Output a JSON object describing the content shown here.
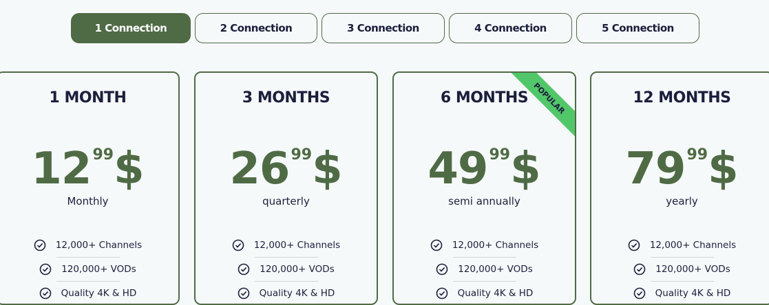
{
  "connections": [
    {
      "label": "1 Connection",
      "active": true
    },
    {
      "label": "2 Connection",
      "active": false
    },
    {
      "label": "3 Connection",
      "active": false
    },
    {
      "label": "4 Connection",
      "active": false
    },
    {
      "label": "5 Connection",
      "active": false
    }
  ],
  "plans": [
    {
      "title": "1 MONTH",
      "price_whole": "12",
      "price_cents": "99",
      "currency": "$",
      "period": "Monthly",
      "features": [
        "12,000+ Channels",
        "120,000+ VODs",
        "Quality 4K & HD"
      ]
    },
    {
      "title": "3 MONTHS",
      "price_whole": "26",
      "price_cents": "99",
      "currency": "$",
      "period": "quarterly",
      "features": [
        "12,000+ Channels",
        "120,000+ VODs",
        "Quality 4K & HD"
      ]
    },
    {
      "title": "6 MONTHS",
      "price_whole": "49",
      "price_cents": "99",
      "currency": "$",
      "period": "semi annually",
      "badge": "POPULAR",
      "features": [
        "12,000+ Channels",
        "120,000+ VODs",
        "Quality 4K & HD"
      ]
    },
    {
      "title": "12 MONTHS",
      "price_whole": "79",
      "price_cents": "99",
      "currency": "$",
      "period": "yearly",
      "features": [
        "12,000+ Channels",
        "120,000+ VODs",
        "Quality 4K & HD"
      ]
    }
  ],
  "colors": {
    "accent": "#4f6b45",
    "badge": "#52c76a",
    "text": "#1b1f3b",
    "background": "#f6f9fa"
  },
  "icons": {
    "feature": "check-circle-icon"
  }
}
